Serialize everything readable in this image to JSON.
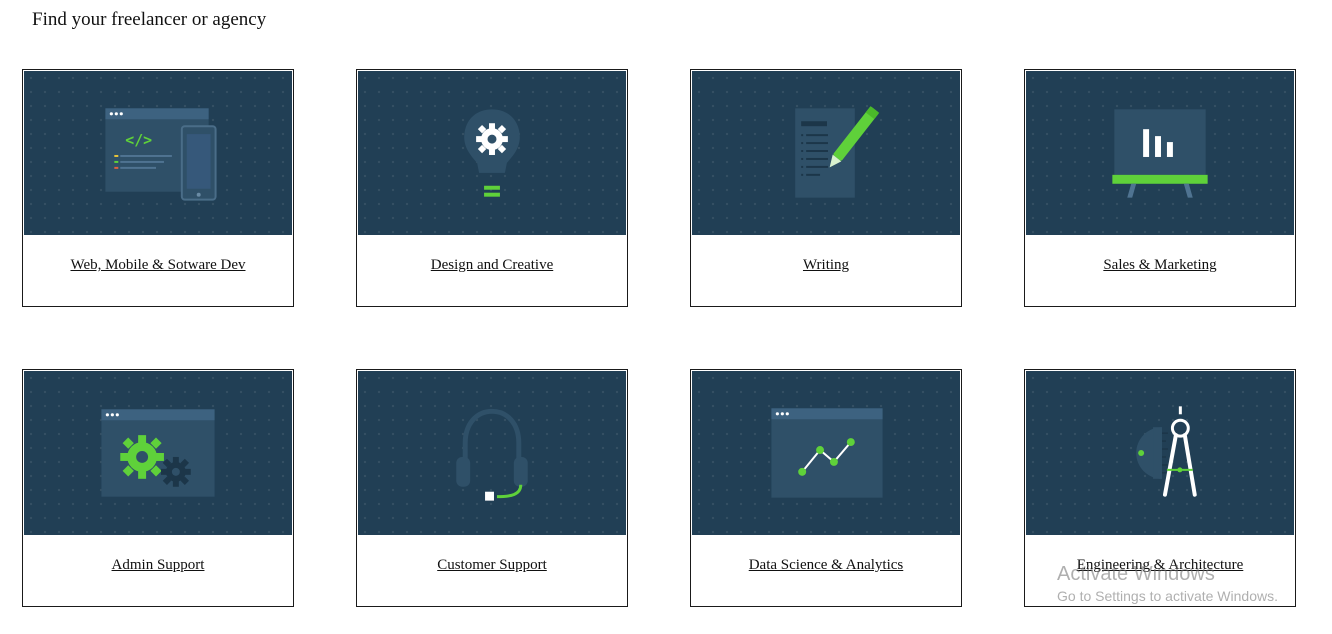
{
  "page": {
    "title": "Find your freelancer or agency"
  },
  "categories": [
    {
      "label": "Web, Mobile & Sotware Dev",
      "icon": "code-window-phone-icon"
    },
    {
      "label": "Design and Creative",
      "icon": "lightbulb-gear-icon"
    },
    {
      "label": "Writing",
      "icon": "document-pen-icon"
    },
    {
      "label": "Sales & Marketing",
      "icon": "presentation-board-icon"
    },
    {
      "label": "Admin Support",
      "icon": "window-gears-icon"
    },
    {
      "label": "Customer Support",
      "icon": "headset-icon"
    },
    {
      "label": "Data Science & Analytics",
      "icon": "window-line-graph-icon"
    },
    {
      "label": "Engineering & Architecture",
      "icon": "compass-protractor-icon"
    }
  ],
  "watermark": {
    "title": "Activate Windows",
    "subtitle": "Go to Settings to activate Windows."
  },
  "colors": {
    "card_art_bg": "#213f55",
    "icon_panel": "#2f5068",
    "accent_green": "#5fd13a",
    "white": "#ffffff"
  }
}
